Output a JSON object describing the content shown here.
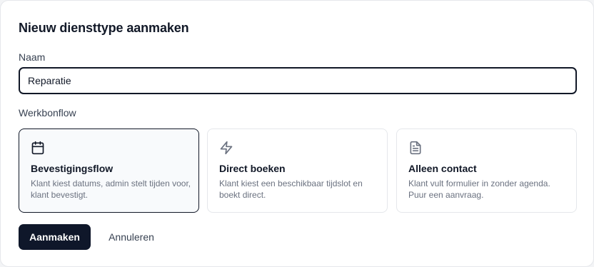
{
  "dialog": {
    "title": "Nieuw diensttype aanmaken"
  },
  "name_field": {
    "label": "Naam",
    "value": "Reparatie"
  },
  "workflow": {
    "label": "Werkbonflow",
    "options": [
      {
        "icon": "calendar-icon",
        "title": "Bevestigingsflow",
        "description": "Klant kiest datums, admin stelt tijden voor, klant bevestigt.",
        "selected": true
      },
      {
        "icon": "lightning-icon",
        "title": "Direct boeken",
        "description": "Klant kiest een beschikbaar tijdslot en boekt direct.",
        "selected": false
      },
      {
        "icon": "document-icon",
        "title": "Alleen contact",
        "description": "Klant vult formulier in zonder agenda. Puur een aanvraag.",
        "selected": false
      }
    ]
  },
  "actions": {
    "create_label": "Aanmaken",
    "cancel_label": "Annuleren"
  },
  "colors": {
    "primary": "#0f172a",
    "selected_border": "#111827",
    "muted_text": "#6b7280",
    "icon": "#6b7280"
  }
}
